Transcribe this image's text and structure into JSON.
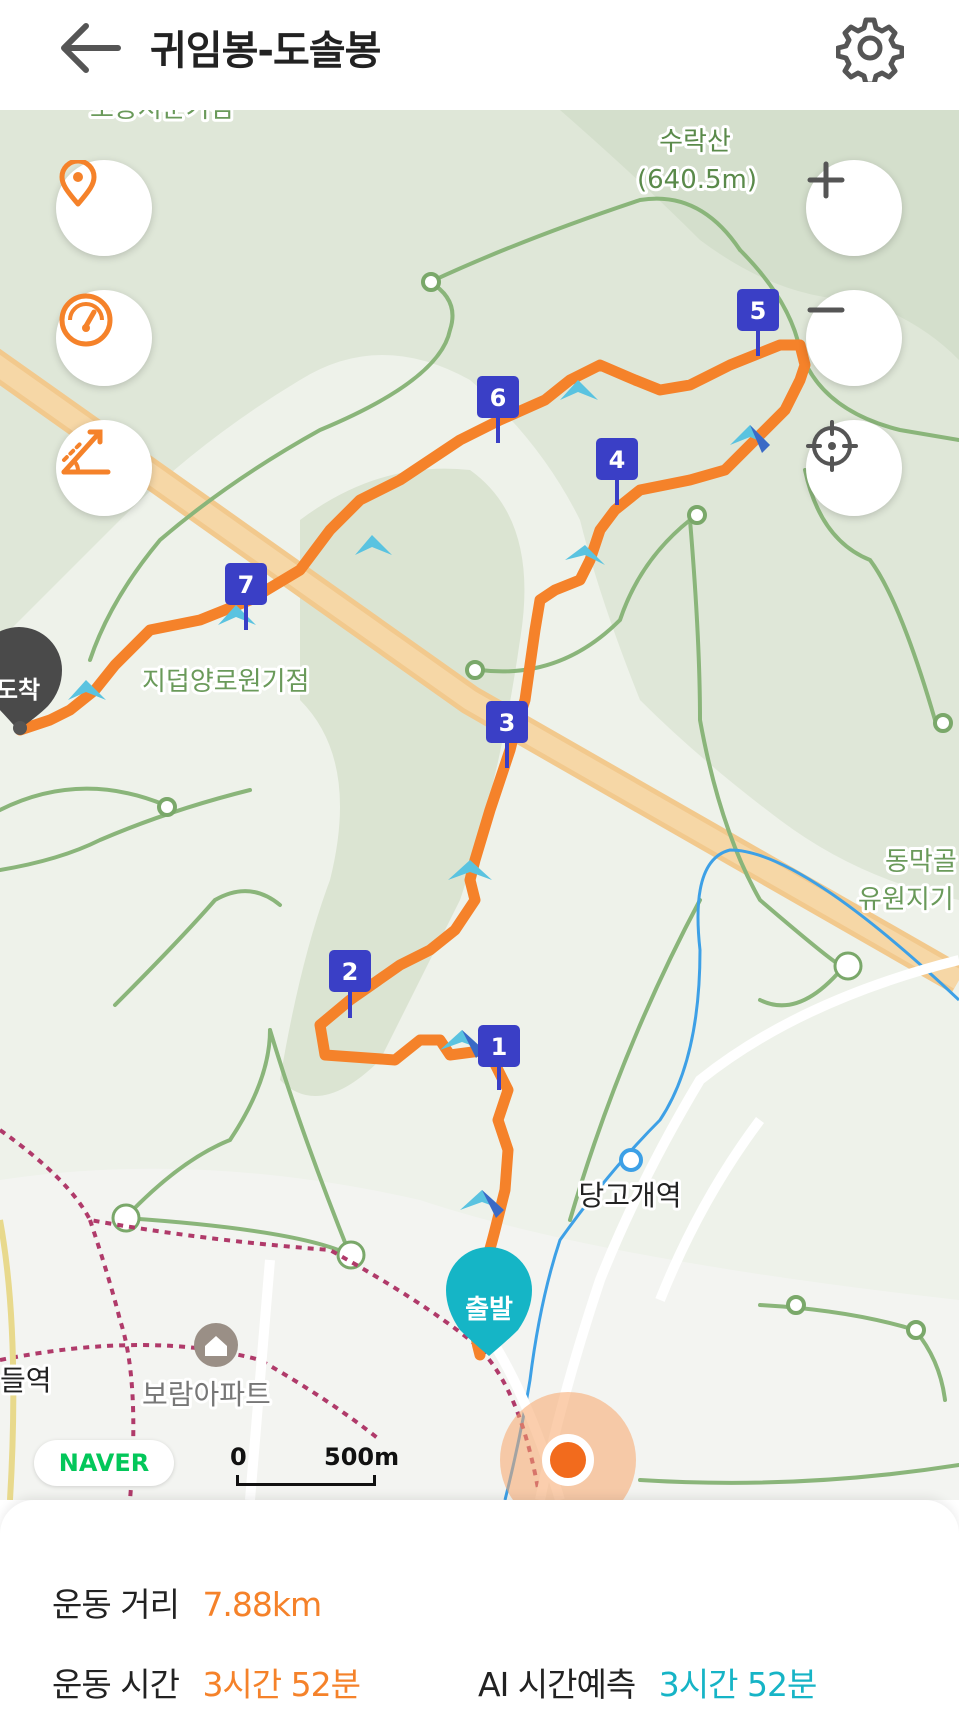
{
  "header": {
    "title": "귀임봉-도솔봉"
  },
  "map": {
    "labels": {
      "mountain_name": "수락산",
      "mountain_height": "(640.5m)",
      "place_top_left": "노동저준기점",
      "place_waypoint": "지덥양로원기점",
      "place_right_1": "동막골",
      "place_right_2": "유원지기",
      "station": "당고개역",
      "station_left": "들역",
      "apartment": "보람아파트"
    },
    "route": {
      "start_label": "출발",
      "end_label": "도착",
      "waypoints": [
        "1",
        "2",
        "3",
        "4",
        "5",
        "6",
        "7"
      ],
      "color": "#f5822a"
    },
    "attribution": "NAVER",
    "scale": {
      "start": "0",
      "end": "500m"
    }
  },
  "controls": {
    "left": [
      "location-pin-icon",
      "speedometer-icon",
      "elevation-icon"
    ],
    "right": [
      "zoom-in-icon",
      "zoom-out-icon",
      "recenter-icon"
    ]
  },
  "stats": {
    "distance_label": "운동 거리",
    "distance_value": "7.88km",
    "time_label": "운동 시간",
    "time_value": "3시간 52분",
    "ai_label": "AI 시간예측",
    "ai_value": "3시간 52분"
  },
  "colors": {
    "accent_orange": "#f5822a",
    "accent_teal": "#16b4c6",
    "marker_blue": "#3a3fc6",
    "trail_green": "#7aa86a"
  }
}
